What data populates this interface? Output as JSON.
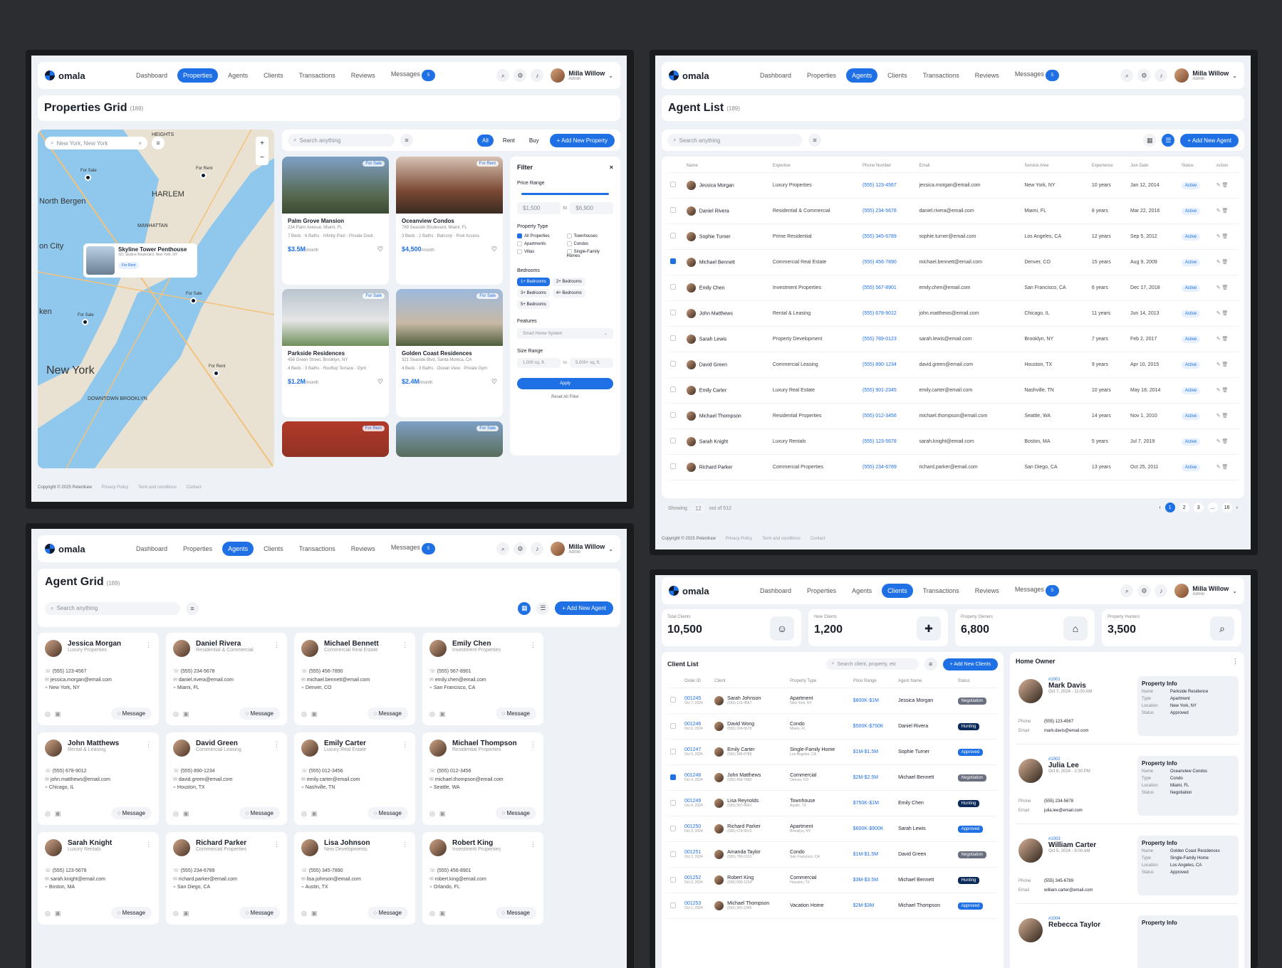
{
  "app": {
    "logo": "omala",
    "user_name": "Milla Willow",
    "user_role": "Admin",
    "nav": [
      "Dashboard",
      "Properties",
      "Agents",
      "Clients",
      "Transactions",
      "Reviews",
      "Messages"
    ],
    "msg_badge": "5"
  },
  "footer": {
    "copyright": "Copyright © 2025 Peterdraw",
    "links": [
      "Privacy Policy",
      "Term and conditions",
      "Contact"
    ]
  },
  "properties": {
    "title": "Properties Grid",
    "count": "(189)",
    "search_placeholder": "Search anything",
    "tabs": [
      "All",
      "Rent",
      "Buy"
    ],
    "add_btn": "+ Add New Property",
    "map_search": "New York, New York",
    "map_labels": [
      "North Bergen",
      "HARLEM",
      "MANHATTAN",
      "on City",
      "ken",
      "New York",
      "DOWNTOWN BROOKLYN",
      "HEIGHTS"
    ],
    "popup": {
      "name": "Skyline Tower Penthouse",
      "addr": "321 Skyline Boulevard, New York, NY",
      "tag": "For Rent"
    },
    "markers": [
      "For Sale",
      "For Rent",
      "For Sale",
      "For Sale",
      "For Rent"
    ],
    "items": [
      {
        "tag": "For Sale",
        "name": "Palm Grove Mansion",
        "addr": "234 Palm Avenue, Miami, FL",
        "feat": "7 Beds · 6 Baths · Infinity Pool · Private Dock",
        "price": "$3.5M",
        "unit": "/month"
      },
      {
        "tag": "For Rent",
        "name": "Oceanview Condos",
        "addr": "789 Seaside Boulevard, Miami, FL",
        "feat": "3 Beds · 2 Baths · Balcony · Pool Access",
        "price": "$4,500",
        "unit": "/month"
      },
      {
        "tag": "For Sale",
        "name": "Parkside Residences",
        "addr": "456 Green Street, Brooklyn, NY",
        "feat": "4 Beds · 3 Baths · Rooftop Terrace · Gym",
        "price": "$1.2M",
        "unit": "/month"
      },
      {
        "tag": "For Sale",
        "name": "Golden Coast Residences",
        "addr": "321 Seaside Blvd, Santa Monica, CA",
        "feat": "4 Beds · 3 Baths · Ocean View · Private Gym",
        "price": "$2.4M",
        "unit": "/month"
      },
      {
        "tag": "For Rent",
        "name": "",
        "addr": "",
        "feat": "",
        "price": "",
        "unit": ""
      },
      {
        "tag": "For Sale",
        "name": "",
        "addr": "",
        "feat": "",
        "price": "",
        "unit": ""
      }
    ],
    "filter": {
      "title": "Filter",
      "price_range": "Price Range",
      "min": "$1,500",
      "to": "to",
      "max": "$6,900",
      "ptype": "Property Type",
      "types": [
        "All Properties",
        "Townhouses",
        "Apartments",
        "Condos",
        "Villas",
        "Single-Family Homes"
      ],
      "bedrooms": "Bedrooms",
      "beds": [
        "1+ Bedrooms",
        "2+ Bedrooms",
        "3+ Bedrooms",
        "4+ Bedrooms",
        "5+ Bedrooms"
      ],
      "features": "Features",
      "feature_sel": "Smart Home System",
      "size": "Size Range",
      "smin": "1,000 sq. ft.",
      "smax": "5,000+ sq. ft.",
      "apply": "Apply",
      "reset": "Reset All Filter"
    }
  },
  "agent_list": {
    "title": "Agent List",
    "count": "(189)",
    "search_placeholder": "Search anything",
    "add_btn": "+ Add New Agent",
    "headers": [
      "Name",
      "Expertise",
      "Phone Number",
      "Email",
      "Service Area",
      "Experience",
      "Join Date",
      "Status",
      "Action"
    ],
    "rows": [
      [
        "Jessica Morgan",
        "Luxury Properties",
        "(555) 123-4567",
        "jessica.morgan@email.com",
        "New York, NY",
        "10 years",
        "Jan 12, 2014",
        "Active"
      ],
      [
        "Daniel Rivera",
        "Residential & Commercial",
        "(555) 234-5678",
        "daniel.rivera@email.com",
        "Miami, FL",
        "8 years",
        "Mar 22, 2016",
        "Active"
      ],
      [
        "Sophie Turner",
        "Prime Residential",
        "(555) 345-6789",
        "sophie.turner@email.com",
        "Los Angeles, CA",
        "12 years",
        "Sep 5, 2012",
        "Active"
      ],
      [
        "Michael Bennett",
        "Commercial Real Estate",
        "(555) 456-7890",
        "michael.bennett@email.com",
        "Denver, CO",
        "15 years",
        "Aug 9, 2009",
        "Active"
      ],
      [
        "Emily Chen",
        "Investment Properties",
        "(555) 567-8901",
        "emily.chen@email.com",
        "San Francisco, CA",
        "6 years",
        "Dec 17, 2018",
        "Active"
      ],
      [
        "John Matthews",
        "Rental & Leasing",
        "(555) 678-9012",
        "john.matthews@email.com",
        "Chicago, IL",
        "11 years",
        "Jun 14, 2013",
        "Active"
      ],
      [
        "Sarah Lewis",
        "Property Development",
        "(555) 789-0123",
        "sarah.lewis@email.com",
        "Brooklyn, NY",
        "7 years",
        "Feb 2, 2017",
        "Active"
      ],
      [
        "David Green",
        "Commercial Leasing",
        "(555) 890-1234",
        "david.green@email.com",
        "Houston, TX",
        "9 years",
        "Apr 10, 2015",
        "Active"
      ],
      [
        "Emily Carter",
        "Luxury Real Estate",
        "(555) 901-2345",
        "emily.carter@email.com",
        "Nashville, TN",
        "10 years",
        "May 18, 2014",
        "Active"
      ],
      [
        "Michael Thompson",
        "Residential Properties",
        "(555) 012-3456",
        "michael.thompson@email.com",
        "Seattle, WA",
        "14 years",
        "Nov 1, 2010",
        "Active"
      ],
      [
        "Sarah Knight",
        "Luxury Rentals",
        "(555) 123-5678",
        "sarah.knight@email.com",
        "Boston, MA",
        "5 years",
        "Jul 7, 2019",
        "Active"
      ],
      [
        "Richard Parker",
        "Commercial Properties",
        "(555) 234-6789",
        "richard.parker@email.com",
        "San Diego, CA",
        "13 years",
        "Oct 25, 2011",
        "Active"
      ]
    ],
    "showing": "Showing",
    "per_page": "12",
    "out_of": "out of 512",
    "pages": [
      "1",
      "2",
      "3",
      "...",
      "16"
    ]
  },
  "agent_grid": {
    "title": "Agent Grid",
    "count": "(189)",
    "search_placeholder": "Search anything",
    "add_btn": "+ Add New Agent",
    "msg_label": "Message",
    "cards": [
      [
        "Jessica Morgan",
        "Luxury Properties",
        "(555) 123-4567",
        "jessica.morgan@email.com",
        "New York, NY"
      ],
      [
        "Daniel Rivera",
        "Residential & Commercial",
        "(555) 234-5678",
        "daniel.rivera@email.com",
        "Miami, FL"
      ],
      [
        "Michael Bennett",
        "Commercial Real Estate",
        "(555) 456-7890",
        "michael.bennett@email.com",
        "Denver, CO"
      ],
      [
        "Emily Chen",
        "Investment Properties",
        "(555) 567-8901",
        "emily.chen@email.com",
        "San Francisco, CA"
      ],
      [
        "John Matthews",
        "Rental & Leasing",
        "(555) 678-9012",
        "john.matthews@email.com",
        "Chicago, IL"
      ],
      [
        "David Green",
        "Commercial Leasing",
        "(555) 890-1234",
        "david.green@email.com",
        "Houston, TX"
      ],
      [
        "Emily Carter",
        "Luxury Real Estate",
        "(555) 012-3456",
        "emily.carter@email.com",
        "Nashville, TN"
      ],
      [
        "Michael Thompson",
        "Residential Properties",
        "(555) 012-3456",
        "michael.thompson@email.com",
        "Seattle, WA"
      ],
      [
        "Sarah Knight",
        "Luxury Rentals",
        "(555) 123-5678",
        "sarah.knight@email.com",
        "Boston, MA"
      ],
      [
        "Richard Parker",
        "Commercial Properties",
        "(555) 234-6789",
        "richard.parker@email.com",
        "San Diego, CA"
      ],
      [
        "Lisa Johnson",
        "New Developments",
        "(555) 345-7890",
        "lisa.johnson@email.com",
        "Austin, TX"
      ],
      [
        "Robert King",
        "Investment Properties",
        "(555) 456-8901",
        "robert.king@email.com",
        "Orlando, FL"
      ]
    ]
  },
  "clients": {
    "stats": [
      {
        "label": "Total Clients",
        "value": "10,500"
      },
      {
        "label": "New Clients",
        "value": "1,200"
      },
      {
        "label": "Property Owners",
        "value": "6,800"
      },
      {
        "label": "Property Hunters",
        "value": "3,500"
      }
    ],
    "list_title": "Client List",
    "search_placeholder": "Search client, property, etc",
    "add_btn": "+ Add New Clients",
    "headers": [
      "Order ID",
      "Client",
      "Property Type",
      "Price Range",
      "Agent Name",
      "Status"
    ],
    "rows": [
      [
        "001245",
        "Oct 7, 2024",
        "Sarah Johnson",
        "(555) 123-4567",
        "Apartment",
        "New York, NY",
        "$800K-$1M",
        "Jessica Morgan",
        "Negotiation",
        "n"
      ],
      [
        "001246",
        "Oct 6, 2024",
        "David Wong",
        "(555) 234-5678",
        "Condo",
        "Miami, FL",
        "$500K-$750K",
        "Daniel Rivera",
        "Hunting",
        "h"
      ],
      [
        "001247",
        "Oct 5, 2024",
        "Emily Carter",
        "(555) 345-6789",
        "Single-Family Home",
        "Los Angeles, CA",
        "$1M-$1.5M",
        "Sophie Turner",
        "Approved",
        "a"
      ],
      [
        "001248",
        "Oct 4, 2024",
        "John Matthews",
        "(555) 456-7890",
        "Commercial",
        "Denver, CO",
        "$2M-$2.5M",
        "Michael Bennett",
        "Negotiation",
        "n"
      ],
      [
        "001249",
        "Oct 4, 2024",
        "Lisa Reynolds",
        "(555) 567-8901",
        "Townhouse",
        "Austin, TX",
        "$750K-$1M",
        "Emily Chen",
        "Hunting",
        "h"
      ],
      [
        "001250",
        "Oct 3, 2024",
        "Richard Parker",
        "(555) 678-9012",
        "Apartment",
        "Brooklyn, NY",
        "$600K-$900K",
        "Sarah Lewis",
        "Approved",
        "a"
      ],
      [
        "001251",
        "Oct 2, 2024",
        "Amanda Taylor",
        "(555) 789-0123",
        "Condo",
        "San Francisco, CA",
        "$1M-$1.5M",
        "David Green",
        "Negotiation",
        "n"
      ],
      [
        "001252",
        "Oct 2, 2024",
        "Robert King",
        "(555) 890-1234",
        "Commercial",
        "Houston, TX",
        "$3M-$3.5M",
        "Michael Bennett",
        "Hunting",
        "h"
      ],
      [
        "001253",
        "Oct 1, 2024",
        "Michael Thompson",
        "(555) 901-2345",
        "Vacation Home",
        "",
        "$2M-$3M",
        "Michael Thompson",
        "Approved",
        "a"
      ]
    ],
    "ho_title": "Home Owner",
    "owners": [
      {
        "id": "#1001",
        "name": "Mark Davis",
        "date": "Oct 7, 2024 - 11:00 AM",
        "phone": "(555) 123-4567",
        "email": "mark.davis@email.com",
        "pname": "Parkside Residence",
        "ptype": "Apartment",
        "loc": "New York, NY",
        "status": "Approved"
      },
      {
        "id": "#1002",
        "name": "Julia Lee",
        "date": "Oct 6, 2024 - 2:30 PM",
        "phone": "(555) 234-5678",
        "email": "julia.lee@email.com",
        "pname": "Oceanview Condos",
        "ptype": "Condo",
        "loc": "Miami, FL",
        "status": "Negotiation"
      },
      {
        "id": "#1003",
        "name": "William Carter",
        "date": "Oct 5, 2024 - 9:00 AM",
        "phone": "(555) 345-6789",
        "email": "william.carter@email.com",
        "pname": "Golden Coast Residences",
        "ptype": "Single-Family Home",
        "loc": "Los Angeles, CA",
        "status": "Approved"
      },
      {
        "id": "#1004",
        "name": "Rebecca Taylor",
        "date": "",
        "phone": "",
        "email": "",
        "pname": "",
        "ptype": "",
        "loc": "",
        "status": ""
      }
    ],
    "info_title": "Property Info",
    "info_labels": [
      "Name",
      "Type",
      "Location",
      "Status"
    ],
    "phone_label": "Phone",
    "email_label": "Email"
  }
}
